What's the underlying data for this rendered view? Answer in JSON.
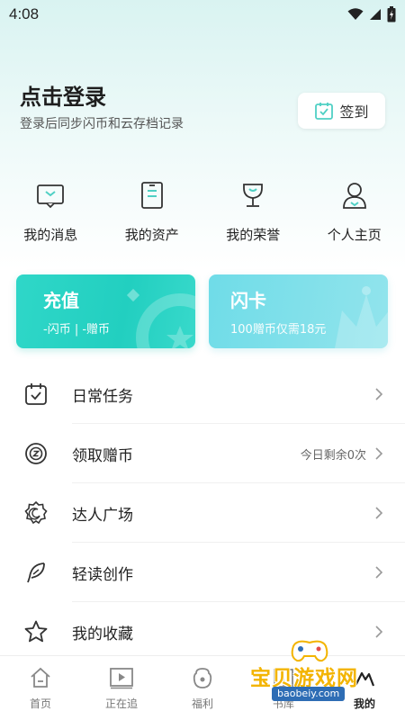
{
  "status_bar": {
    "time": "4:08"
  },
  "header": {
    "title": "点击登录",
    "subtitle": "登录后同步闪币和云存档记录",
    "checkin_label": "签到"
  },
  "quick_links": [
    {
      "label": "我的消息",
      "icon": "message-icon"
    },
    {
      "label": "我的资产",
      "icon": "assets-icon"
    },
    {
      "label": "我的荣誉",
      "icon": "trophy-icon"
    },
    {
      "label": "个人主页",
      "icon": "profile-icon"
    }
  ],
  "cards": {
    "recharge": {
      "title": "充值",
      "subtitle": "-闪币 | -赠币",
      "color": "#2fd7c8"
    },
    "flash_card": {
      "title": "闪卡",
      "subtitle": "100赠币仅需18元",
      "color": "#7fdfea"
    }
  },
  "menu": [
    {
      "label": "日常任务",
      "right_text": "",
      "icon": "calendar-check-icon"
    },
    {
      "label": "领取赠币",
      "right_text": "今日剩余0次",
      "icon": "coin-icon"
    },
    {
      "label": "达人广场",
      "right_text": "",
      "icon": "badge-icon"
    },
    {
      "label": "轻读创作",
      "right_text": "",
      "icon": "feather-icon"
    },
    {
      "label": "我的收藏",
      "right_text": "",
      "icon": "star-icon"
    }
  ],
  "tabbar": [
    {
      "label": "首页",
      "icon": "home-icon",
      "active": false
    },
    {
      "label": "正在追",
      "icon": "play-icon",
      "active": false
    },
    {
      "label": "福利",
      "icon": "gift-icon",
      "active": false
    },
    {
      "label": "书库",
      "icon": "library-icon",
      "active": false
    },
    {
      "label": "我的",
      "icon": "mine-icon",
      "active": true
    }
  ],
  "watermark": {
    "text": "宝贝游戏网",
    "url": "baobeiy.com"
  }
}
